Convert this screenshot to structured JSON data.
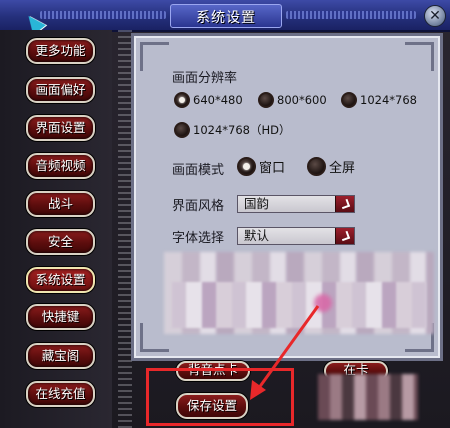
{
  "window": {
    "title": "系统设置",
    "close_glyph": "✕"
  },
  "sidebar": {
    "items": [
      {
        "label": "更多功能"
      },
      {
        "label": "画面偏好"
      },
      {
        "label": "界面设置"
      },
      {
        "label": "音频视频"
      },
      {
        "label": "战斗"
      },
      {
        "label": "安全"
      },
      {
        "label": "系统设置"
      },
      {
        "label": "快捷键"
      },
      {
        "label": "藏宝阁"
      },
      {
        "label": "在线充值"
      }
    ]
  },
  "resolution": {
    "label": "画面分辨率",
    "options": [
      "640*480",
      "800*600",
      "1024*768",
      "1024*768（HD）"
    ],
    "selected": "640*480"
  },
  "display_mode": {
    "label": "画面模式",
    "options": [
      "窗口",
      "全屏"
    ],
    "selected": "窗口"
  },
  "ui_style": {
    "label": "界面风格",
    "value": "国韵"
  },
  "font_choice": {
    "label": "字体选择",
    "value": "默认"
  },
  "bottom_buttons": {
    "partial_left": "背音点卡",
    "save": "保存设置",
    "partial_right": "在卡"
  },
  "colors": {
    "annotation": "#e8282a",
    "button_fill": "#6b0f0f",
    "panel": "#b9bccd"
  },
  "icons": {
    "close": "close-icon",
    "cursor": "cursor-icon",
    "dropdown": "chevron-down-icon"
  }
}
